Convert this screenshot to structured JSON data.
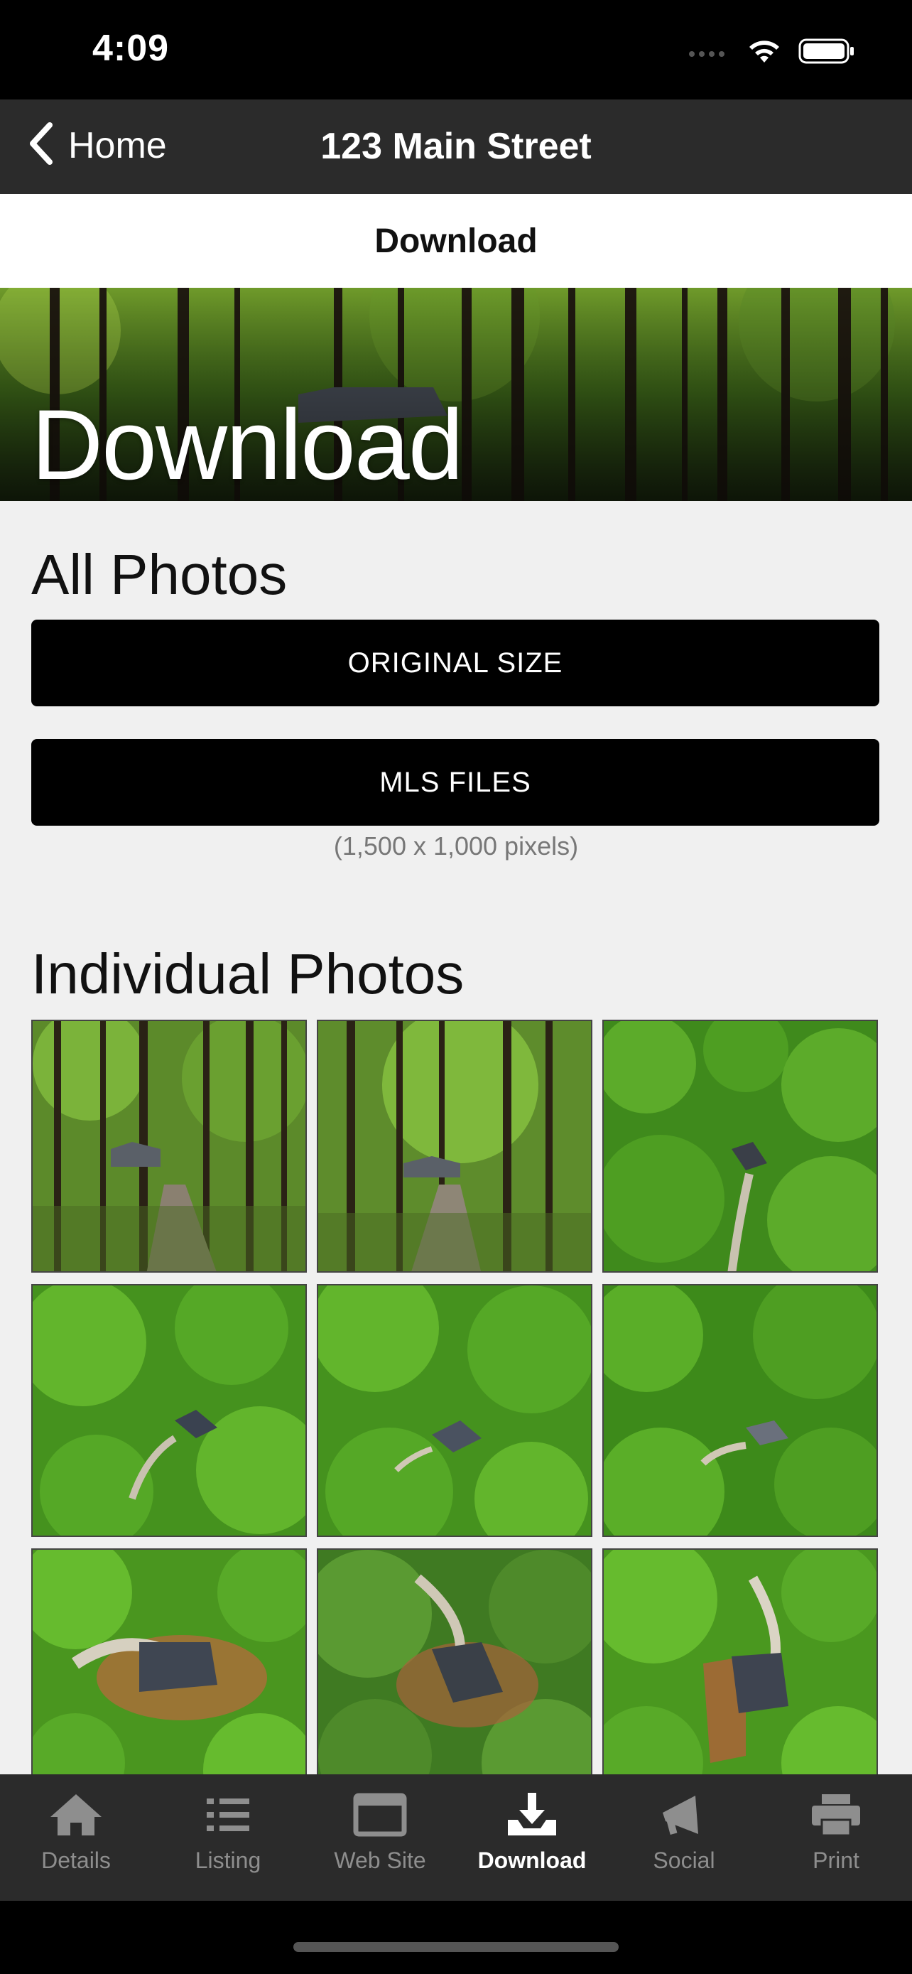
{
  "status": {
    "time": "4:09"
  },
  "nav": {
    "back_label": "Home",
    "title": "123 Main Street"
  },
  "subtitle": "Download",
  "hero": {
    "title": "Download"
  },
  "all_photos": {
    "heading": "All Photos",
    "original_button": "ORIGINAL SIZE",
    "mls_button": "MLS FILES",
    "mls_note": "(1,500 x 1,000 pixels)"
  },
  "individual": {
    "heading": "Individual Photos",
    "photo_count_visible": 9
  },
  "tabs": [
    {
      "label": "Details",
      "icon": "house-icon",
      "active": false
    },
    {
      "label": "Listing",
      "icon": "list-icon",
      "active": false
    },
    {
      "label": "Web Site",
      "icon": "browser-window-icon",
      "active": false
    },
    {
      "label": "Download",
      "icon": "download-tray-icon",
      "active": true
    },
    {
      "label": "Social",
      "icon": "megaphone-icon",
      "active": false
    },
    {
      "label": "Print",
      "icon": "printer-icon",
      "active": false
    }
  ],
  "colors": {
    "nav_bg": "#2b2b2b",
    "button_bg": "#000000",
    "content_bg": "#f0f0f0",
    "tab_inactive": "#8e8e8e",
    "tab_active": "#ffffff"
  }
}
